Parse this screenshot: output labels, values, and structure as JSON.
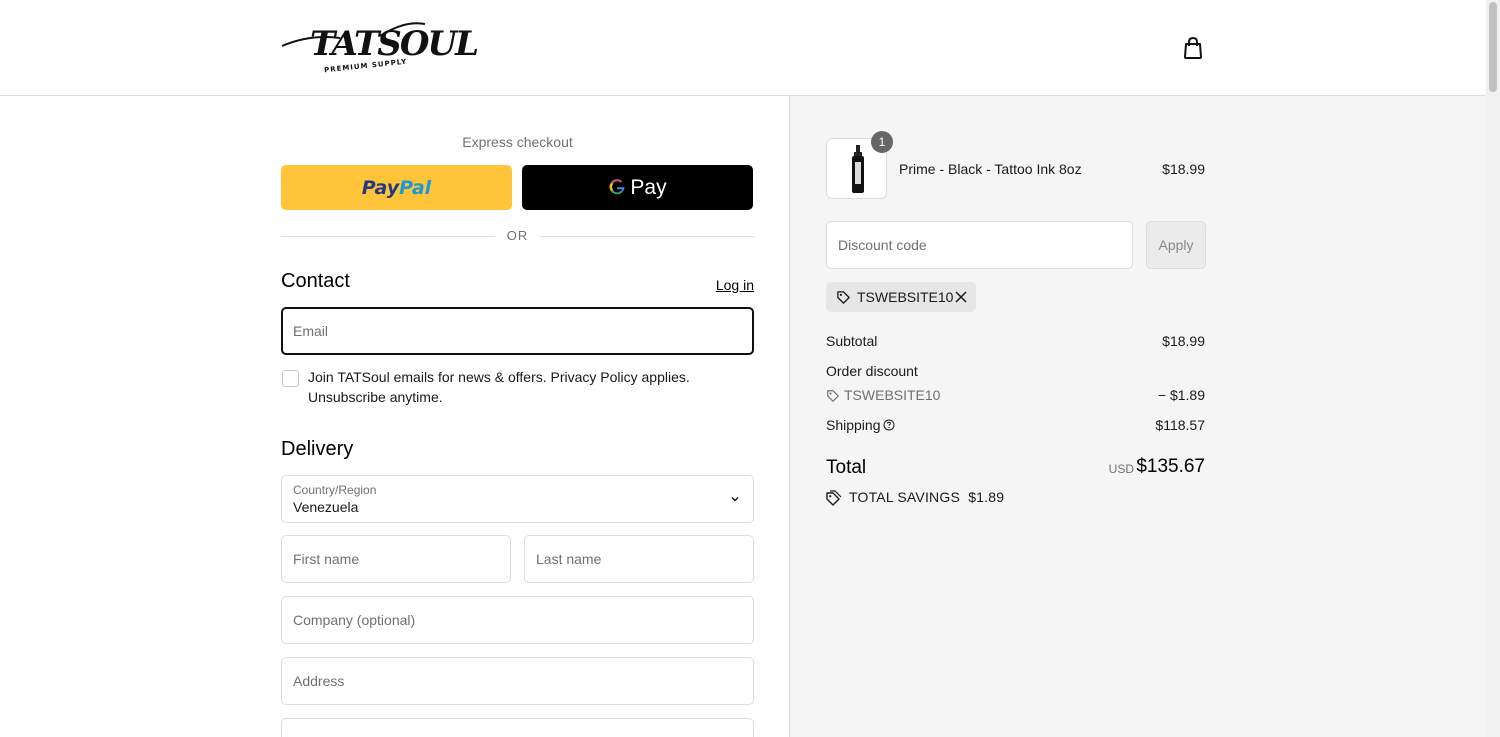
{
  "brand": {
    "logo_main": "TATSOUL",
    "logo_sub": "PREMIUM SUPPLY"
  },
  "express": {
    "title": "Express checkout",
    "paypal_a": "Pay",
    "paypal_b": "Pal",
    "gpay_g": "G",
    "gpay_label": "Pay",
    "or": "OR"
  },
  "contact": {
    "title": "Contact",
    "login": "Log in",
    "email_placeholder": "Email",
    "newsletter": "Join TATSoul emails for news & offers. Privacy Policy applies. Unsubscribe anytime."
  },
  "delivery": {
    "title": "Delivery",
    "country_label": "Country/Region",
    "country_value": "Venezuela",
    "first_name_placeholder": "First name",
    "last_name_placeholder": "Last name",
    "company_placeholder": "Company (optional)",
    "address_placeholder": "Address"
  },
  "summary": {
    "item": {
      "name": "Prime - Black - Tattoo Ink 8oz",
      "price": "$18.99",
      "quantity": "1"
    },
    "discount_placeholder": "Discount code",
    "apply": "Apply",
    "applied_code": "TSWEBSITE10",
    "subtotal_label": "Subtotal",
    "subtotal_value": "$18.99",
    "order_discount_label": "Order discount",
    "discount_code": "TSWEBSITE10",
    "discount_value": "− $1.89",
    "shipping_label": "Shipping",
    "shipping_value": "$118.57",
    "total_label": "Total",
    "currency": "USD",
    "total_value": "$135.67",
    "savings_label": "TOTAL SAVINGS",
    "savings_value": "$1.89"
  },
  "colors": {
    "paypal": "#ffc439",
    "gpay": "#000000",
    "accent": "#1a1a1a"
  }
}
